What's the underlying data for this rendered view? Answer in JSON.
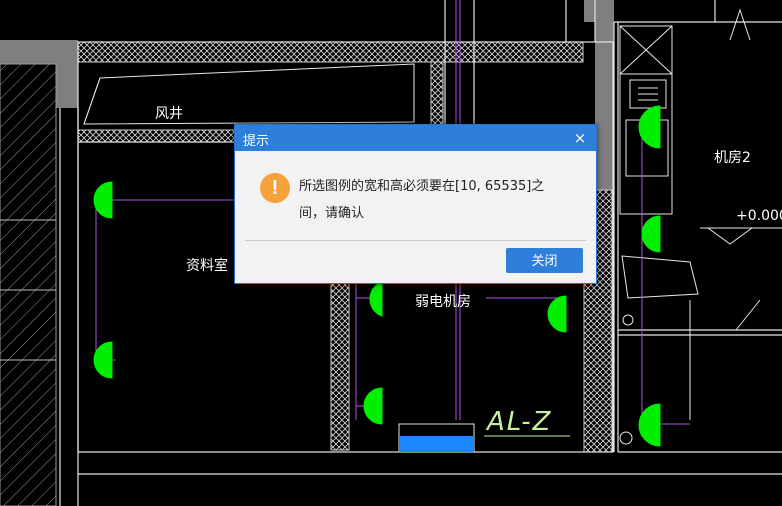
{
  "drawing": {
    "room_labels": {
      "air_shaft": "风井",
      "archive_room": "资料室",
      "weak_current_room": "弱电机房",
      "equipment_room": "机房2"
    },
    "tag_text": "AL-Z",
    "elevation_text": "+0.000"
  },
  "dialog": {
    "title": "提示",
    "close_glyph": "×",
    "icon_glyph": "!",
    "message": "所选图例的宽和高必须要在[10, 65535]之间，请确认",
    "ok_label": "关闭"
  },
  "colors": {
    "dialog_titlebar": "#2d7fd9",
    "dialog_button": "#2d7fd9",
    "warning_icon": "#f5a13c",
    "symbol_green": "#00ee00",
    "wire_purple": "#b050e0",
    "cad_background": "#000000",
    "gray_fill": "#808080"
  }
}
